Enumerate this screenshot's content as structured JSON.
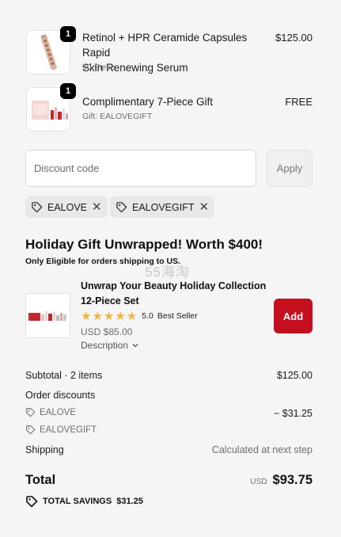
{
  "line_items": [
    {
      "quantity": "1",
      "title_line1": "Retinol + HPR Ceramide Capsules Rapid",
      "title_line2": "Skin Renewing Serum",
      "subtitle": "90-Piece",
      "price": "$125.00",
      "icon": "serum-bottle-image"
    },
    {
      "quantity": "1",
      "title_line1": "Complimentary 7-Piece Gift",
      "subtitle": "Gift: EALOVEGIFT",
      "price": "FREE",
      "icon": "gift-set-image"
    }
  ],
  "discount": {
    "placeholder": "Discount code",
    "apply_label": "Apply",
    "applied_codes": [
      "EALOVE",
      "EALOVEGIFT"
    ]
  },
  "promo": {
    "title": "Holiday Gift Unwrapped! Worth $400!",
    "subtitle": "Only Eligible for orders shipping to US.",
    "watermark": "55海淘",
    "offer": {
      "title_line1": "Unwrap Your Beauty Holiday Collection",
      "title_line2": "12-Piece Set",
      "stars": "★★★★★",
      "rating": "5.0",
      "badge": "Best Seller",
      "price": "USD $85.00",
      "description_label": "Description",
      "add_label": "Add"
    }
  },
  "summary": {
    "subtotal_label": "Subtotal · 2 items",
    "subtotal_value": "$125.00",
    "discounts_label": "Order discounts",
    "discount_lines": [
      {
        "code": "EALOVE",
        "amount": "− $31.25"
      },
      {
        "code": "EALOVEGIFT",
        "amount": ""
      }
    ],
    "shipping_label": "Shipping",
    "shipping_value": "Calculated at next step",
    "total_label": "Total",
    "total_currency": "USD",
    "total_value": "$93.75",
    "savings_label": "TOTAL SAVINGS",
    "savings_value": "$31.25"
  },
  "colors": {
    "accent_red": "#c40f1f",
    "star": "#f4b43a",
    "background": "#f5f5f5"
  }
}
